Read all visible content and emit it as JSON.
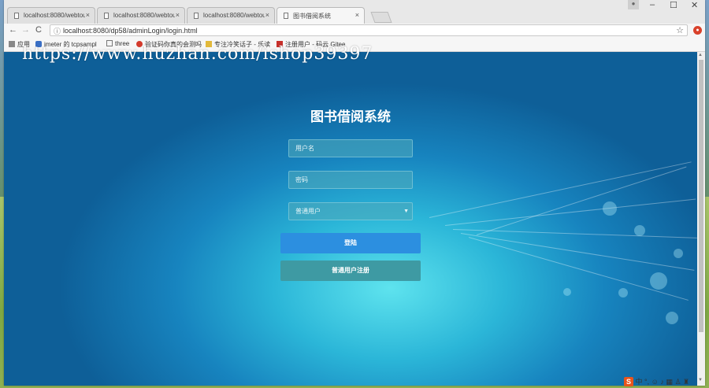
{
  "tabs": [
    {
      "label": "localhost:8080/webtou",
      "close": "×"
    },
    {
      "label": "localhost:8080/webtou",
      "close": "×"
    },
    {
      "label": "localhost:8080/webtou",
      "close": "×"
    },
    {
      "label": "图书借阅系统",
      "close": "×"
    }
  ],
  "window": {
    "minimize": "–",
    "maximize": "☐",
    "close": "✕"
  },
  "toolbar": {
    "back": "←",
    "forward": "→",
    "reload": "C",
    "url": "localhost:8080/dp58/adminLogin/login.html",
    "star": "☆"
  },
  "bookmarks": [
    {
      "label": "应用",
      "icon_color": "#888888"
    },
    {
      "label": "jmeter 的 tcpsampl",
      "icon_color": "#3a6fc4"
    },
    {
      "label": "three",
      "icon_color": "#777777"
    },
    {
      "label": "验证码你真的会测吗",
      "icon_color": "#d33a2c"
    },
    {
      "label": "专注冷笑话子 - 乐读",
      "icon_color": "#e2b93b"
    },
    {
      "label": "注册用户 - 码云 Gitee",
      "icon_color": "#c7302b"
    }
  ],
  "watermark": "https://www.huzhan.com/ishop39397",
  "login": {
    "title": "图书借阅系统",
    "username_placeholder": "用户名",
    "password_placeholder": "密码",
    "role_selected": "普通用户",
    "login_button": "登陆",
    "register_button": "普通用户注册"
  },
  "tray": {
    "sogou": "S",
    "lang": "中"
  },
  "colors": {
    "accent_blue": "#2c8fe0",
    "register_teal": "#3e9aa3"
  }
}
